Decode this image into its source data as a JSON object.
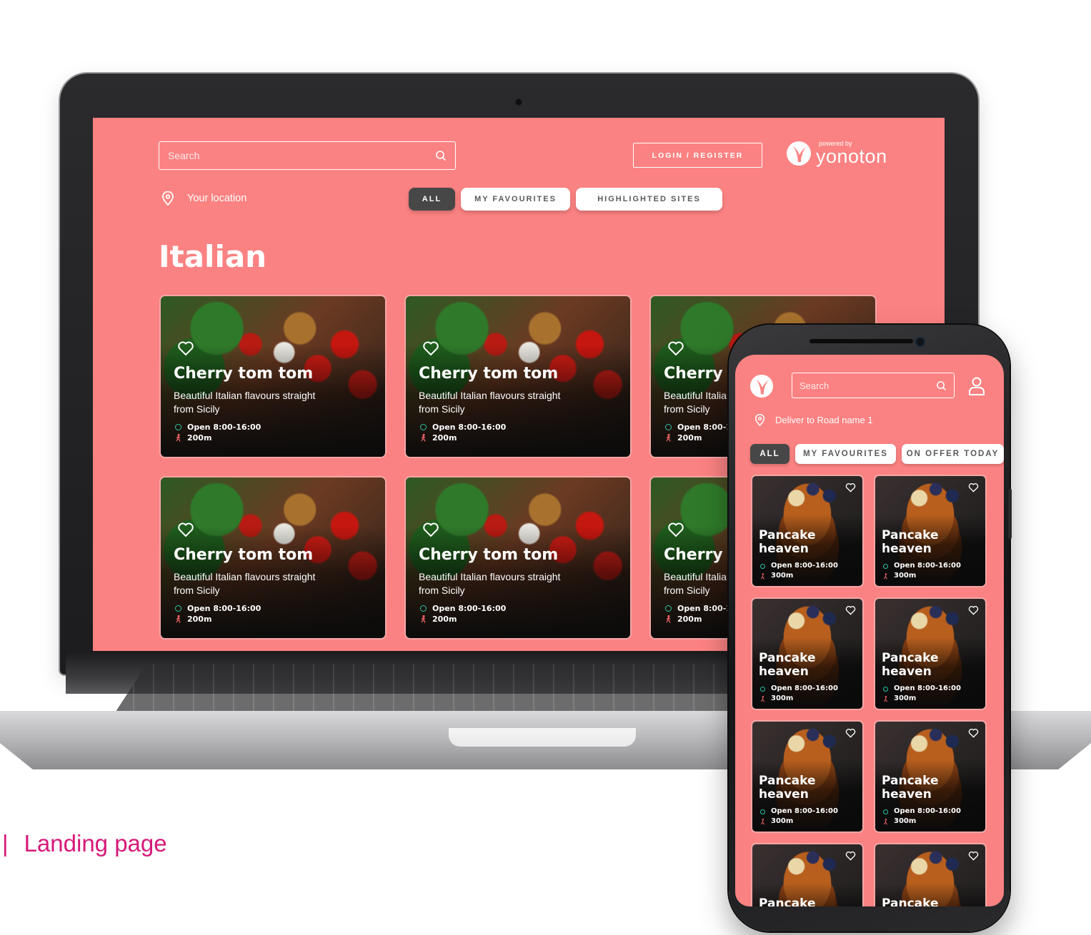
{
  "desktop": {
    "search_placeholder": "Search",
    "login_label": "LOGIN / REGISTER",
    "logo": {
      "powered_by": "powered by",
      "brand": "yonoton"
    },
    "location_label": "Your location",
    "filters": [
      "ALL",
      "MY FAVOURITES",
      "HIGHLIGHTED SITES"
    ],
    "active_filter": "ALL",
    "section_title": "Italian",
    "cards": [
      {
        "title": "Cherry tom tom",
        "description": "Beautiful Italian flavours straight from Sicily",
        "hours": "Open 8:00-16:00",
        "distance": "200m"
      },
      {
        "title": "Cherry tom tom",
        "description": "Beautiful Italian flavours straight from Sicily",
        "hours": "Open 8:00-16:00",
        "distance": "200m"
      },
      {
        "title": "Cherry tom tom",
        "description": "Beautiful Italian flavours straight from Sicily",
        "hours": "Open 8:00-16:00",
        "distance": "200m"
      },
      {
        "title": "Cherry tom tom",
        "description": "Beautiful Italian flavours straight from Sicily",
        "hours": "Open 8:00-16:00",
        "distance": "200m"
      },
      {
        "title": "Cherry tom tom",
        "description": "Beautiful Italian flavours straight from Sicily",
        "hours": "Open 8:00-16:00",
        "distance": "200m"
      },
      {
        "title": "Cherry tom tom",
        "description": "Beautiful Italian flavours straight from Sicily",
        "hours": "Open 8:00-16:00",
        "distance": "200m"
      }
    ]
  },
  "mobile": {
    "search_placeholder": "Search",
    "location_label": "Deliver to Road name 1",
    "filters": [
      "ALL",
      "MY FAVOURITES",
      "ON OFFER TODAY"
    ],
    "active_filter": "ALL",
    "cards": [
      {
        "title": "Pancake heaven",
        "hours": "Open 8:00-16:00",
        "distance": "300m"
      },
      {
        "title": "Pancake heaven",
        "hours": "Open 8:00-16:00",
        "distance": "300m"
      },
      {
        "title": "Pancake heaven",
        "hours": "Open 8:00-16:00",
        "distance": "300m"
      },
      {
        "title": "Pancake heaven",
        "hours": "Open 8:00-16:00",
        "distance": "300m"
      },
      {
        "title": "Pancake heaven",
        "hours": "Open 8:00-16:00",
        "distance": "300m"
      },
      {
        "title": "Pancake heaven",
        "hours": "Open 8:00-16:00",
        "distance": "300m"
      },
      {
        "title": "Pancake",
        "hours": "",
        "distance": ""
      },
      {
        "title": "Pancake",
        "hours": "",
        "distance": ""
      }
    ]
  },
  "caption": {
    "bar": "|",
    "text": "Landing page"
  },
  "colors": {
    "brand_coral": "#fb8282",
    "chip_dark": "#474747",
    "open_indicator": "#2ec4a6",
    "distance_indicator": "#ff6b6b",
    "caption": "#d6197a"
  },
  "icons": [
    "search-icon",
    "location-pin-icon",
    "heart-icon",
    "open-status-icon",
    "walking-icon",
    "yonoton-logo-icon",
    "user-icon"
  ]
}
